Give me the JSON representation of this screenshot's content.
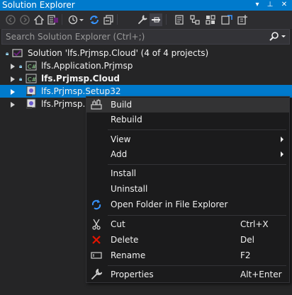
{
  "window": {
    "title": "Solution Explorer"
  },
  "search": {
    "placeholder": "Search Solution Explorer (Ctrl+;)"
  },
  "tree": {
    "solution": {
      "label": "Solution 'lfs.Prjmsp.Cloud' (4 of 4 projects)"
    },
    "projects": [
      {
        "label": "lfs.Application.Prjmsp",
        "bold": false
      },
      {
        "label": "lfs.Prjmsp.Cloud",
        "bold": true
      },
      {
        "label": "lfs.Prjmsp.Setup32",
        "bold": false
      },
      {
        "label": "lfs.Prjmsp.Se",
        "bold": false
      }
    ]
  },
  "context_menu": {
    "items": [
      {
        "label": "Build",
        "icon": "build-icon",
        "shortcut": ""
      },
      {
        "label": "Rebuild",
        "icon": "",
        "shortcut": ""
      },
      {
        "label": "View",
        "icon": "",
        "shortcut": ""
      },
      {
        "label": "Add",
        "icon": "",
        "shortcut": ""
      },
      {
        "label": "Install",
        "icon": "",
        "shortcut": ""
      },
      {
        "label": "Uninstall",
        "icon": "",
        "shortcut": ""
      },
      {
        "label": "Open Folder in File Explorer",
        "icon": "refresh-folder-icon",
        "shortcut": ""
      },
      {
        "label": "Cut",
        "icon": "scissors-icon",
        "shortcut": "Ctrl+X"
      },
      {
        "label": "Delete",
        "icon": "delete-icon",
        "shortcut": "Del"
      },
      {
        "label": "Rename",
        "icon": "rename-icon",
        "shortcut": "F2"
      },
      {
        "label": "Properties",
        "icon": "wrench-icon",
        "shortcut": "Alt+Enter"
      }
    ]
  },
  "colors": {
    "accent": "#007acc",
    "background": "#252526",
    "menu_background": "#1b1b1c",
    "delete_red": "#e51400",
    "csharp_green": "#68217a"
  }
}
